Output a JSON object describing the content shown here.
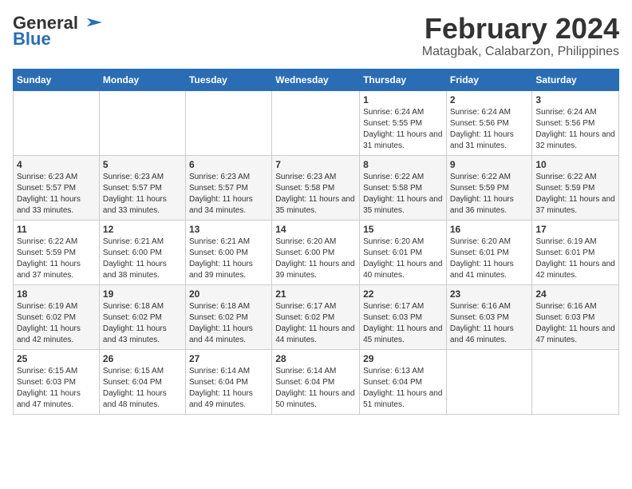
{
  "header": {
    "logo_general": "General",
    "logo_blue": "Blue",
    "month": "February 2024",
    "location": "Matagbak, Calabarzon, Philippines"
  },
  "days_of_week": [
    "Sunday",
    "Monday",
    "Tuesday",
    "Wednesday",
    "Thursday",
    "Friday",
    "Saturday"
  ],
  "weeks": [
    [
      {
        "day": "",
        "info": ""
      },
      {
        "day": "",
        "info": ""
      },
      {
        "day": "",
        "info": ""
      },
      {
        "day": "",
        "info": ""
      },
      {
        "day": "1",
        "info": "Sunrise: 6:24 AM\nSunset: 5:55 PM\nDaylight: 11 hours and 31 minutes."
      },
      {
        "day": "2",
        "info": "Sunrise: 6:24 AM\nSunset: 5:56 PM\nDaylight: 11 hours and 31 minutes."
      },
      {
        "day": "3",
        "info": "Sunrise: 6:24 AM\nSunset: 5:56 PM\nDaylight: 11 hours and 32 minutes."
      }
    ],
    [
      {
        "day": "4",
        "info": "Sunrise: 6:23 AM\nSunset: 5:57 PM\nDaylight: 11 hours and 33 minutes."
      },
      {
        "day": "5",
        "info": "Sunrise: 6:23 AM\nSunset: 5:57 PM\nDaylight: 11 hours and 33 minutes."
      },
      {
        "day": "6",
        "info": "Sunrise: 6:23 AM\nSunset: 5:57 PM\nDaylight: 11 hours and 34 minutes."
      },
      {
        "day": "7",
        "info": "Sunrise: 6:23 AM\nSunset: 5:58 PM\nDaylight: 11 hours and 35 minutes."
      },
      {
        "day": "8",
        "info": "Sunrise: 6:22 AM\nSunset: 5:58 PM\nDaylight: 11 hours and 35 minutes."
      },
      {
        "day": "9",
        "info": "Sunrise: 6:22 AM\nSunset: 5:59 PM\nDaylight: 11 hours and 36 minutes."
      },
      {
        "day": "10",
        "info": "Sunrise: 6:22 AM\nSunset: 5:59 PM\nDaylight: 11 hours and 37 minutes."
      }
    ],
    [
      {
        "day": "11",
        "info": "Sunrise: 6:22 AM\nSunset: 5:59 PM\nDaylight: 11 hours and 37 minutes."
      },
      {
        "day": "12",
        "info": "Sunrise: 6:21 AM\nSunset: 6:00 PM\nDaylight: 11 hours and 38 minutes."
      },
      {
        "day": "13",
        "info": "Sunrise: 6:21 AM\nSunset: 6:00 PM\nDaylight: 11 hours and 39 minutes."
      },
      {
        "day": "14",
        "info": "Sunrise: 6:20 AM\nSunset: 6:00 PM\nDaylight: 11 hours and 39 minutes."
      },
      {
        "day": "15",
        "info": "Sunrise: 6:20 AM\nSunset: 6:01 PM\nDaylight: 11 hours and 40 minutes."
      },
      {
        "day": "16",
        "info": "Sunrise: 6:20 AM\nSunset: 6:01 PM\nDaylight: 11 hours and 41 minutes."
      },
      {
        "day": "17",
        "info": "Sunrise: 6:19 AM\nSunset: 6:01 PM\nDaylight: 11 hours and 42 minutes."
      }
    ],
    [
      {
        "day": "18",
        "info": "Sunrise: 6:19 AM\nSunset: 6:02 PM\nDaylight: 11 hours and 42 minutes."
      },
      {
        "day": "19",
        "info": "Sunrise: 6:18 AM\nSunset: 6:02 PM\nDaylight: 11 hours and 43 minutes."
      },
      {
        "day": "20",
        "info": "Sunrise: 6:18 AM\nSunset: 6:02 PM\nDaylight: 11 hours and 44 minutes."
      },
      {
        "day": "21",
        "info": "Sunrise: 6:17 AM\nSunset: 6:02 PM\nDaylight: 11 hours and 44 minutes."
      },
      {
        "day": "22",
        "info": "Sunrise: 6:17 AM\nSunset: 6:03 PM\nDaylight: 11 hours and 45 minutes."
      },
      {
        "day": "23",
        "info": "Sunrise: 6:16 AM\nSunset: 6:03 PM\nDaylight: 11 hours and 46 minutes."
      },
      {
        "day": "24",
        "info": "Sunrise: 6:16 AM\nSunset: 6:03 PM\nDaylight: 11 hours and 47 minutes."
      }
    ],
    [
      {
        "day": "25",
        "info": "Sunrise: 6:15 AM\nSunset: 6:03 PM\nDaylight: 11 hours and 47 minutes."
      },
      {
        "day": "26",
        "info": "Sunrise: 6:15 AM\nSunset: 6:04 PM\nDaylight: 11 hours and 48 minutes."
      },
      {
        "day": "27",
        "info": "Sunrise: 6:14 AM\nSunset: 6:04 PM\nDaylight: 11 hours and 49 minutes."
      },
      {
        "day": "28",
        "info": "Sunrise: 6:14 AM\nSunset: 6:04 PM\nDaylight: 11 hours and 50 minutes."
      },
      {
        "day": "29",
        "info": "Sunrise: 6:13 AM\nSunset: 6:04 PM\nDaylight: 11 hours and 51 minutes."
      },
      {
        "day": "",
        "info": ""
      },
      {
        "day": "",
        "info": ""
      }
    ]
  ]
}
